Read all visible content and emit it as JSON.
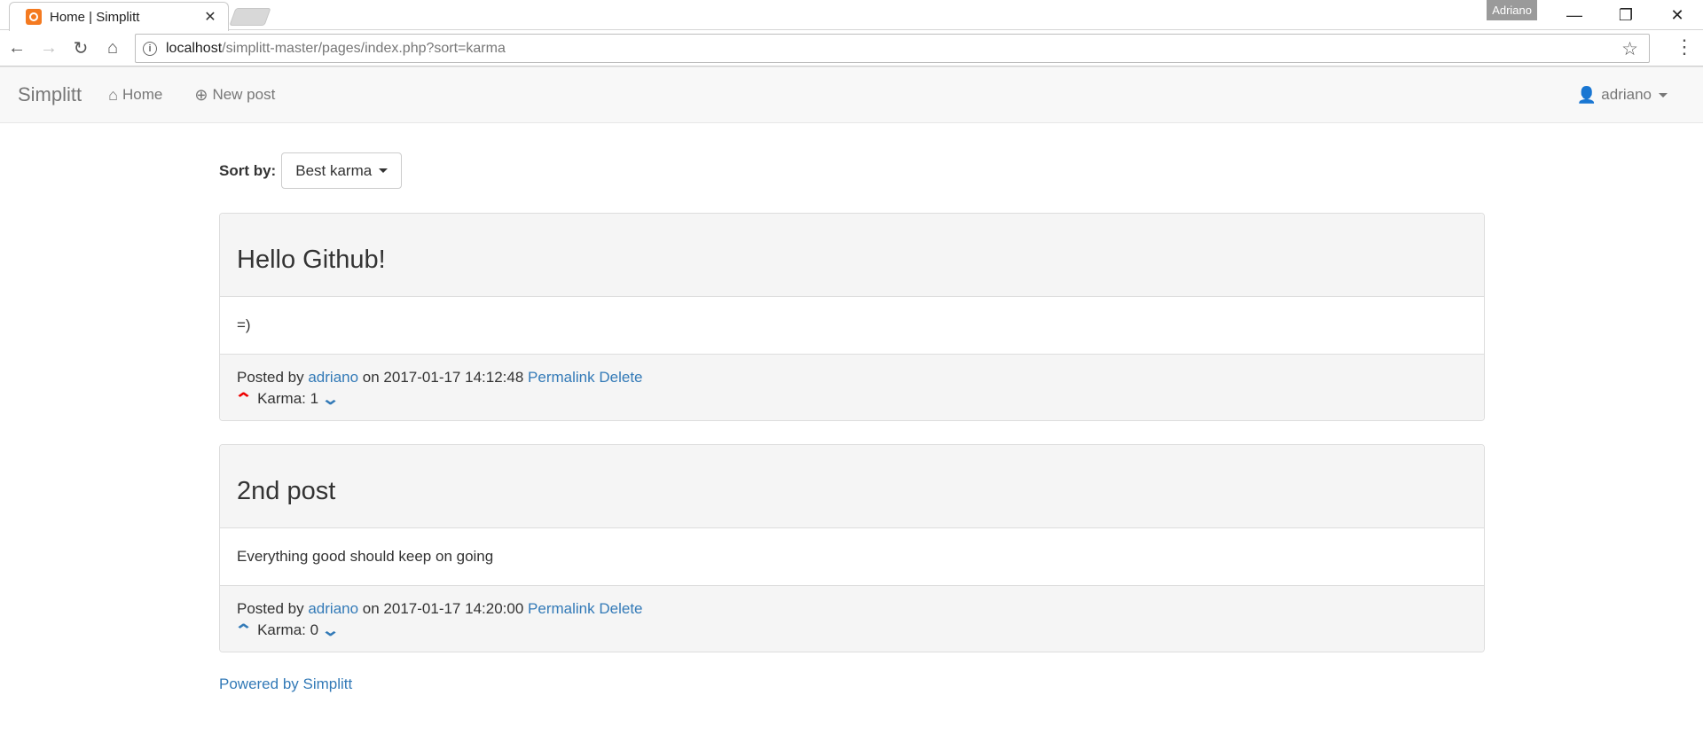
{
  "browser": {
    "tab_title": "Home | Simplitt",
    "user_chip": "Adriano",
    "url_host": "localhost",
    "url_rest": "/simplitt-master/pages/index.php?sort=karma"
  },
  "navbar": {
    "brand": "Simplitt",
    "home_label": "Home",
    "new_post_label": "New post",
    "user_label": "adriano"
  },
  "sort": {
    "label": "Sort by:",
    "selected": "Best karma"
  },
  "posts": [
    {
      "title": "Hello Github!",
      "body": "=)",
      "posted_by_prefix": "Posted by",
      "author": "adriano",
      "on_text": "on 2017-01-17 14:12:48",
      "permalink_label": "Permalink",
      "delete_label": "Delete",
      "karma_text": "Karma: 1",
      "upvoted": true
    },
    {
      "title": "2nd post",
      "body": "Everything good should keep on going",
      "posted_by_prefix": "Posted by",
      "author": "adriano",
      "on_text": "on 2017-01-17 14:20:00",
      "permalink_label": "Permalink",
      "delete_label": "Delete",
      "karma_text": "Karma: 0",
      "upvoted": false
    }
  ],
  "footer": {
    "powered_by": "Powered by Simplitt"
  },
  "colors": {
    "link": "#337ab7",
    "upvote_active": "#ee0000",
    "navbar_bg": "#f8f8f8",
    "panel_bg": "#f5f5f5"
  },
  "icons": {
    "back": "arrow-left-icon",
    "forward": "arrow-right-icon",
    "reload": "reload-icon",
    "home": "home-icon",
    "new_post": "plus-circle-icon",
    "user": "user-icon",
    "upvote": "chevron-up-icon",
    "downvote": "chevron-down-icon"
  }
}
